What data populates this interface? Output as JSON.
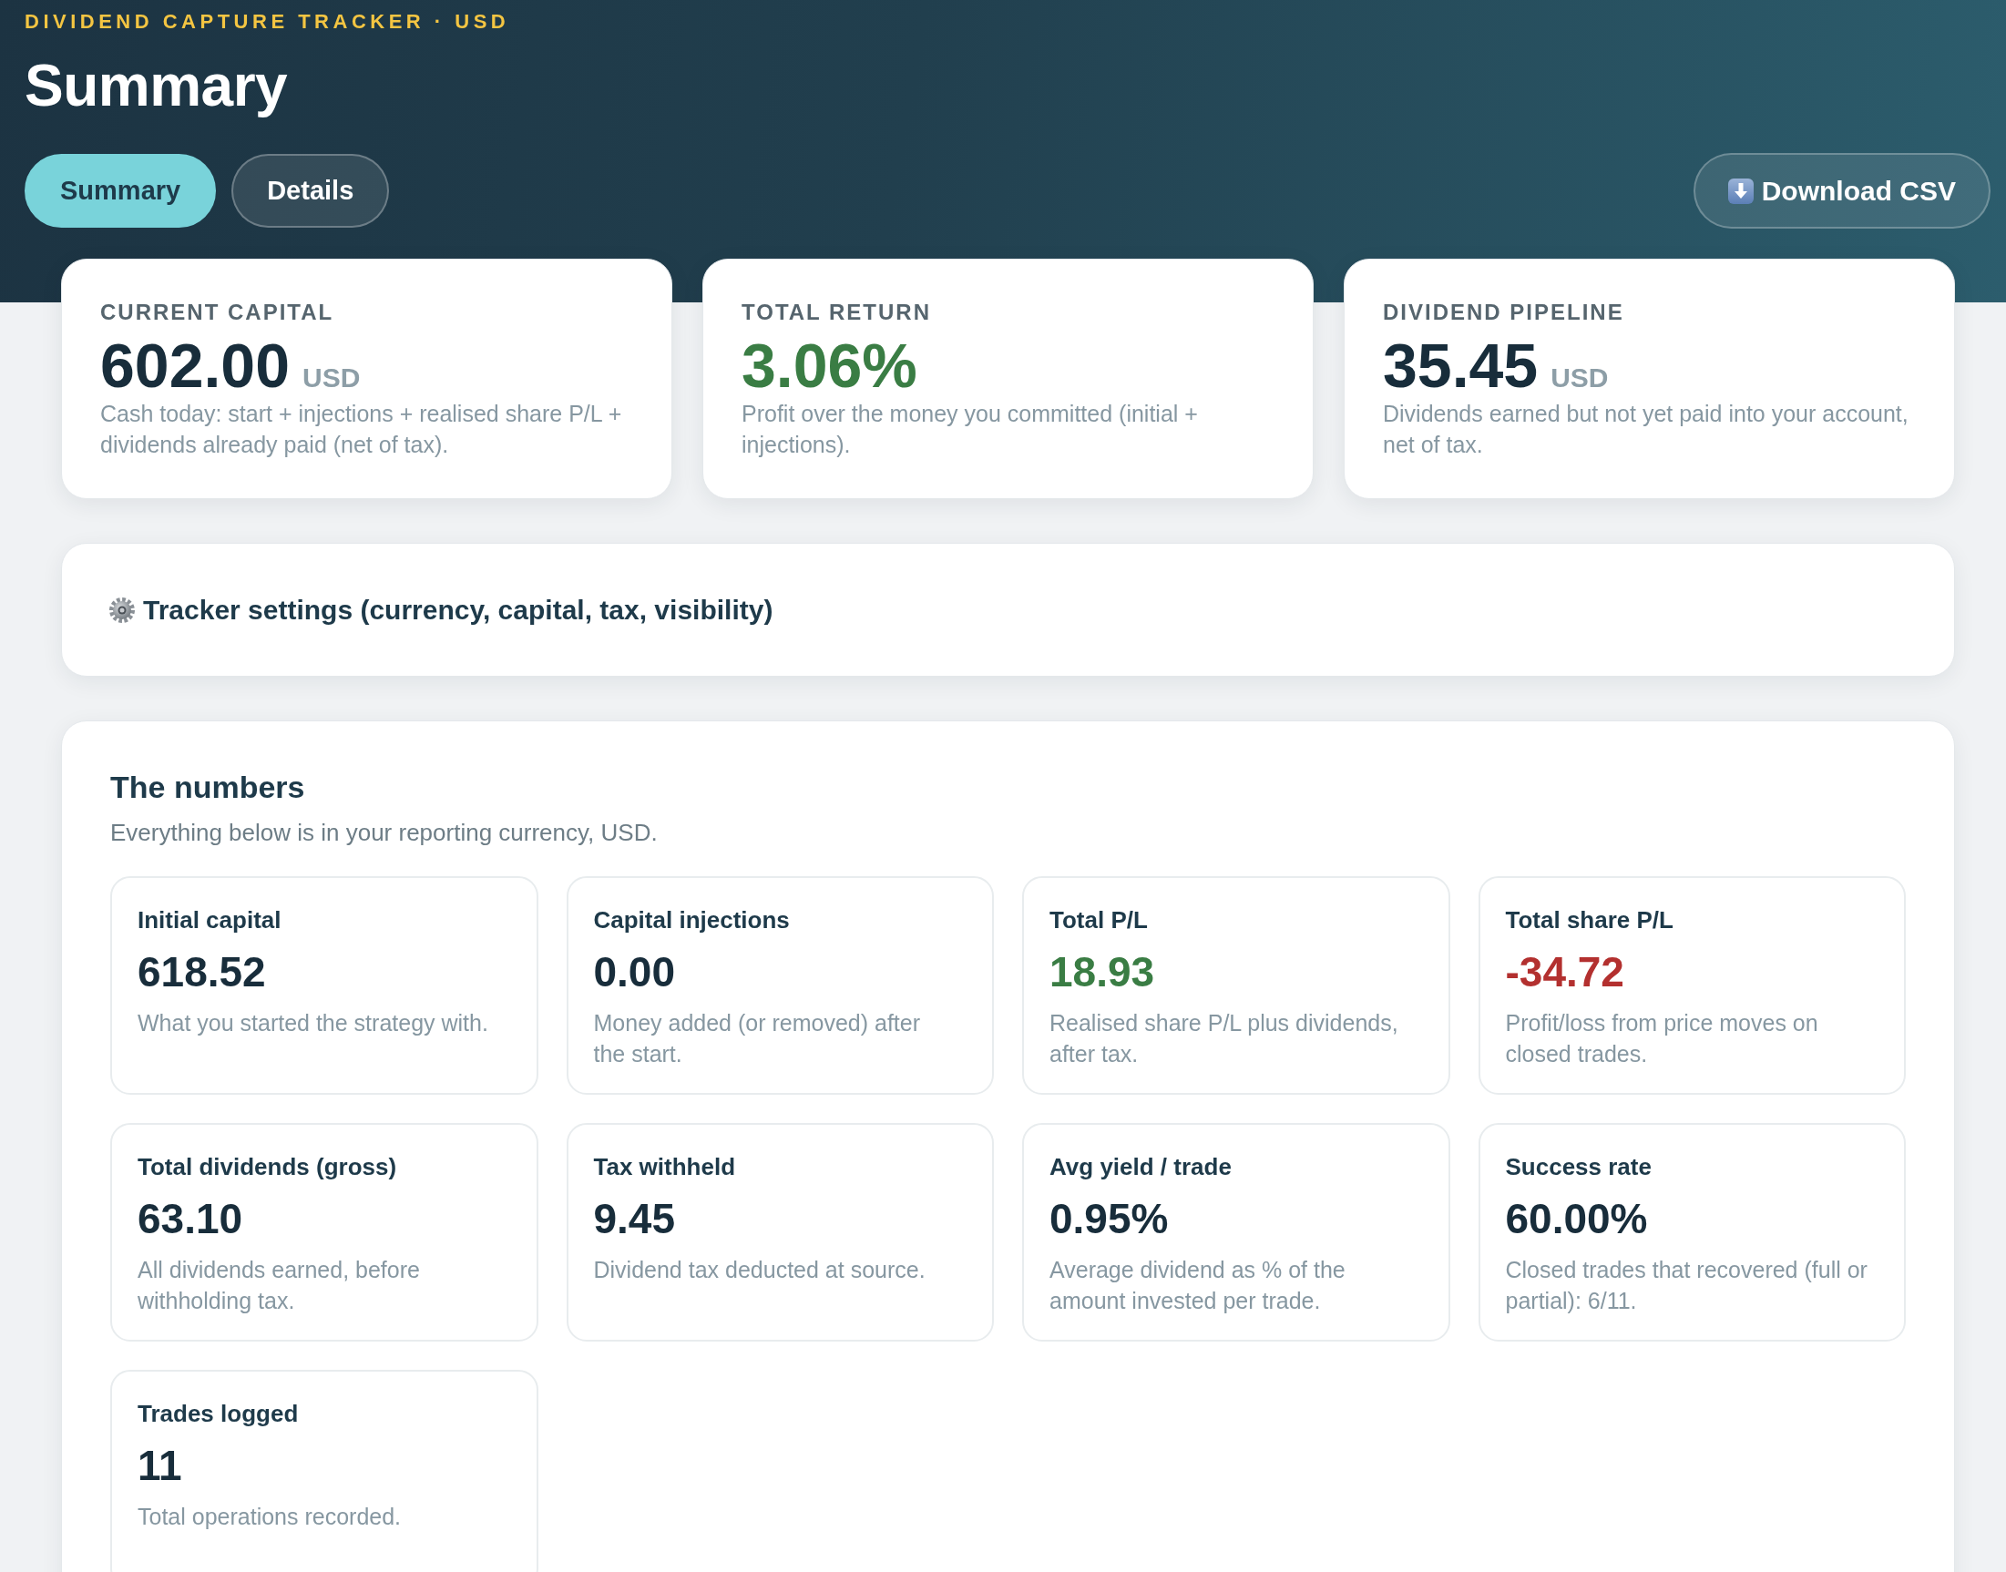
{
  "header": {
    "eyebrow": "DIVIDEND CAPTURE TRACKER · USD",
    "title": "Summary"
  },
  "tabs": [
    {
      "label": "Summary",
      "selected": true
    },
    {
      "label": "Details",
      "selected": false
    }
  ],
  "download_button": {
    "label": "Download CSV"
  },
  "kpi_cards": [
    {
      "label": "CURRENT CAPITAL",
      "value": "602.00",
      "unit": "USD",
      "color": "#182d3b",
      "description": "Cash today: start + injections + realised share P/L + dividends already paid (net of tax)."
    },
    {
      "label": "TOTAL RETURN",
      "value": "3.06%",
      "color": "#3a7d44",
      "description": "Profit over the money you committed (initial + injections)."
    },
    {
      "label": "DIVIDEND PIPELINE",
      "value": "35.45",
      "unit": "USD",
      "color": "#182d3b",
      "description": "Dividends earned but not yet paid into your account, net of tax."
    }
  ],
  "settings": {
    "label": "Tracker settings (currency, capital, tax, visibility)"
  },
  "numbers": {
    "title": "The numbers",
    "subtitle": "Everything below is in your reporting currency, USD.",
    "metrics": [
      {
        "label": "Initial capital",
        "value": "618.52",
        "color": "#182d3b",
        "description": "What you started the strategy with."
      },
      {
        "label": "Capital injections",
        "value": "0.00",
        "color": "#182d3b",
        "description": "Money added (or removed) after the start."
      },
      {
        "label": "Total P/L",
        "value": "18.93",
        "color": "#3a7d44",
        "description": "Realised share P/L plus dividends, after tax."
      },
      {
        "label": "Total share P/L",
        "value": "-34.72",
        "color": "#b3302f",
        "description": "Profit/loss from price moves on closed trades."
      },
      {
        "label": "Total dividends (gross)",
        "value": "63.10",
        "color": "#182d3b",
        "description": "All dividends earned, before withholding tax."
      },
      {
        "label": "Tax withheld",
        "value": "9.45",
        "color": "#182d3b",
        "description": "Dividend tax deducted at source."
      },
      {
        "label": "Avg yield / trade",
        "value": "0.95%",
        "color": "#182d3b",
        "description": "Average dividend as % of the amount invested per trade."
      },
      {
        "label": "Success rate",
        "value": "60.00%",
        "color": "#182d3b",
        "description": "Closed trades that recovered (full or partial): 6/11."
      },
      {
        "label": "Trades logged",
        "value": "11",
        "color": "#182d3b",
        "description": "Total operations recorded."
      }
    ]
  }
}
